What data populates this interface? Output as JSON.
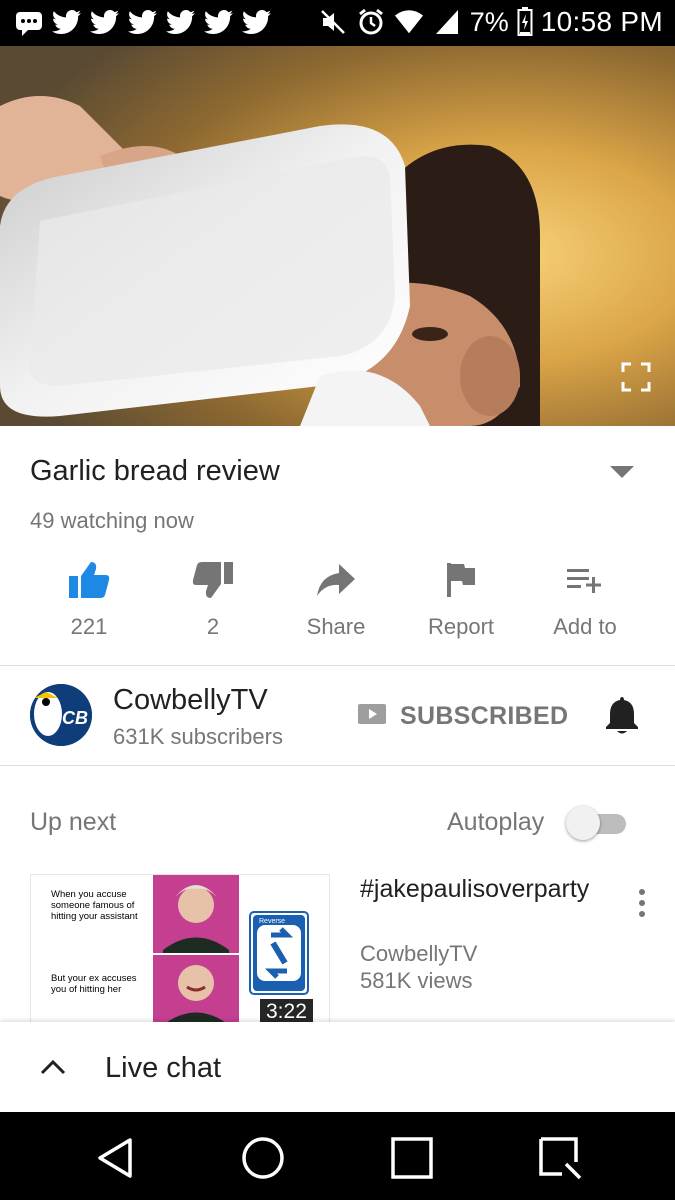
{
  "status_bar": {
    "battery": "7%",
    "time": "10:58 PM",
    "notification_icons": [
      "message-icon",
      "twitter-icon",
      "twitter-icon",
      "twitter-icon",
      "twitter-icon",
      "twitter-icon",
      "twitter-icon"
    ],
    "system_icons": [
      "mute-icon",
      "alarm-icon",
      "wifi-icon",
      "signal-icon",
      "battery-icon"
    ]
  },
  "video": {
    "title": "Garlic bread review",
    "watching": "49 watching now"
  },
  "actions": {
    "like_count": "221",
    "dislike_count": "2",
    "share_label": "Share",
    "report_label": "Report",
    "add_to_label": "Add to"
  },
  "channel": {
    "name": "CowbellyTV",
    "subscribers": "631K subscribers",
    "subscribed_label": "SUBSCRIBED",
    "avatar_text": "CB"
  },
  "up_next": {
    "heading": "Up next",
    "autoplay_label": "Autoplay",
    "autoplay_on": false,
    "item": {
      "title": "#jakepaulisoverparty",
      "channel": "CowbellyTV",
      "views": "581K views",
      "duration": "3:22",
      "thumb_text_top": "When you accuse someone famous of hitting your assistant",
      "thumb_text_bottom": "But your ex accuses you of hitting her",
      "thumb_card_label": "Reverse"
    }
  },
  "live_chat": {
    "label": "Live chat"
  },
  "colors": {
    "accent_blue": "#1e88e5",
    "secondary_text": "#767676",
    "primary_text": "#212121"
  }
}
